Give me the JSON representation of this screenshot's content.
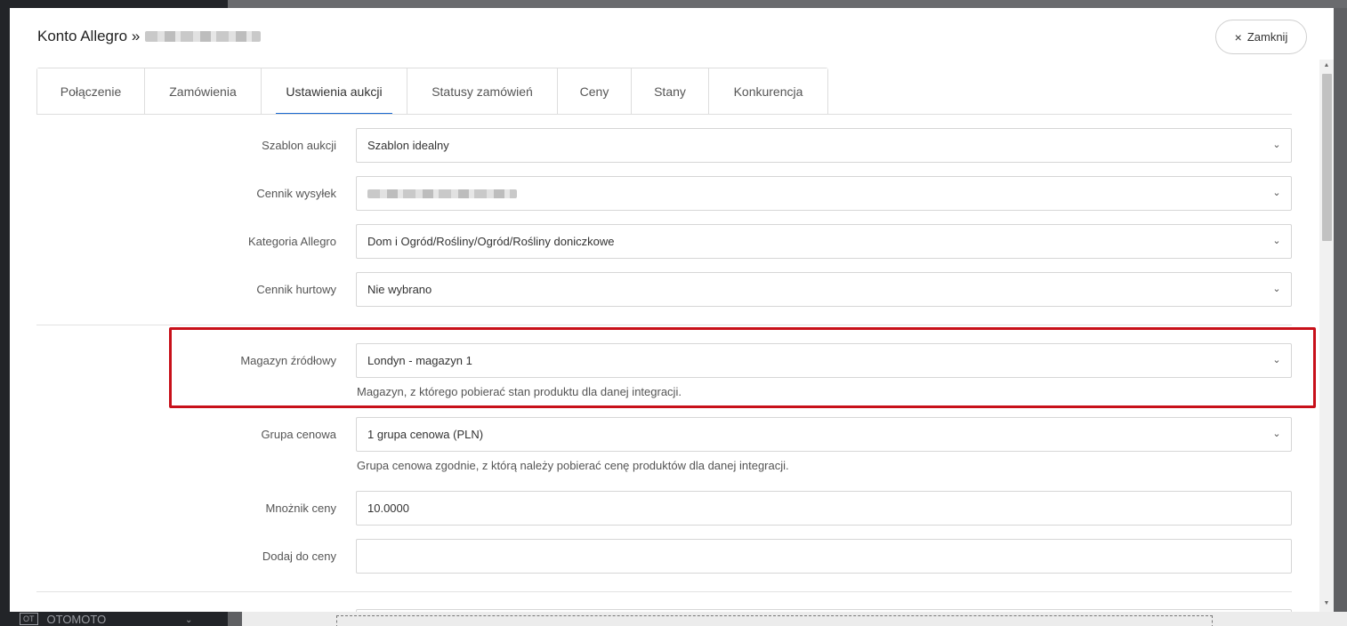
{
  "background": {
    "sidebar_bottom_badge": "OT",
    "sidebar_bottom_item": "OTOMOTO"
  },
  "modal": {
    "title": "Konto Allegro »",
    "close_label": "Zamknij",
    "tabs": [
      {
        "label": "Połączenie"
      },
      {
        "label": "Zamówienia"
      },
      {
        "label": "Ustawienia aukcji"
      },
      {
        "label": "Statusy zamówień"
      },
      {
        "label": "Ceny"
      },
      {
        "label": "Stany"
      },
      {
        "label": "Konkurencja"
      }
    ],
    "active_tab": "Ustawienia aukcji",
    "fields": {
      "szablon_aukcji": {
        "label": "Szablon aukcji",
        "value": "Szablon idealny"
      },
      "cennik_wysylek": {
        "label": "Cennik wysyłek",
        "value": ""
      },
      "kategoria_allegro": {
        "label": "Kategoria Allegro",
        "value": "Dom i Ogród/Rośliny/Ogród/Rośliny doniczkowe"
      },
      "cennik_hurtowy": {
        "label": "Cennik hurtowy",
        "value": "Nie wybrano"
      },
      "magazyn_zrodlowy": {
        "label": "Magazyn źródłowy",
        "value": "Londyn - magazyn 1",
        "help": "Magazyn, z którego pobierać stan produktu dla danej integracji."
      },
      "grupa_cenowa": {
        "label": "Grupa cenowa",
        "value": "1 grupa cenowa (PLN)",
        "help": "Grupa cenowa zgodnie, z którą należy pobierać cenę produktów dla danej integracji."
      },
      "mnoznik_ceny": {
        "label": "Mnożnik ceny",
        "value": "10.0000"
      },
      "dodaj_do_ceny": {
        "label": "Dodaj do ceny",
        "value": ""
      }
    }
  },
  "colors": {
    "highlight": "#c8101a",
    "active_tab_underline": "#1c6bd1"
  }
}
